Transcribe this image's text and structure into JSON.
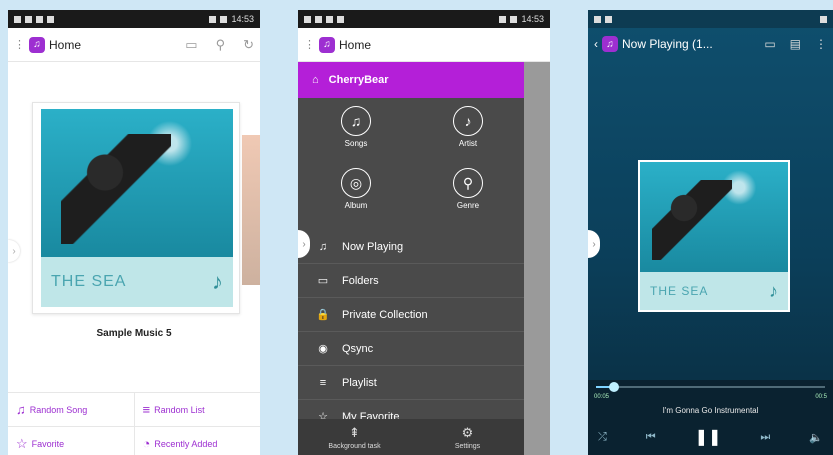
{
  "status_time": "14:53",
  "screen1": {
    "app_title": "Home",
    "album_title": "THE SEA",
    "album_caption": "Sample Music 5",
    "quick_actions": [
      {
        "label": "Random Song",
        "icon": "♫"
      },
      {
        "label": "Random List",
        "icon": "≡"
      },
      {
        "label": "Favorite",
        "icon": "☆"
      },
      {
        "label": "Recently Added",
        "icon": "◔"
      }
    ]
  },
  "screen2": {
    "app_title": "Home",
    "user": "CherryBear",
    "categories": [
      {
        "label": "Songs",
        "icon": "♫"
      },
      {
        "label": "Artist",
        "icon": "♪"
      },
      {
        "label": "Album",
        "icon": "◎"
      },
      {
        "label": "Genre",
        "icon": "⚲"
      }
    ],
    "menu": [
      {
        "label": "Now Playing",
        "icon": "♫"
      },
      {
        "label": "Folders",
        "icon": "▭"
      },
      {
        "label": "Private Collection",
        "icon": "🔒"
      },
      {
        "label": "Qsync",
        "icon": "◉"
      },
      {
        "label": "Playlist",
        "icon": "≡"
      },
      {
        "label": "My Favorite",
        "icon": "☆"
      }
    ],
    "footer": [
      {
        "label": "Background task",
        "icon": "⇞"
      },
      {
        "label": "Settings",
        "icon": "⚙"
      }
    ]
  },
  "screen3": {
    "title": "Now Playing (1...",
    "album_title": "THE SEA",
    "elapsed": "00:05",
    "duration": "00:5",
    "track": "I'm Gonna Go Instrumental",
    "progress": 0.08
  }
}
